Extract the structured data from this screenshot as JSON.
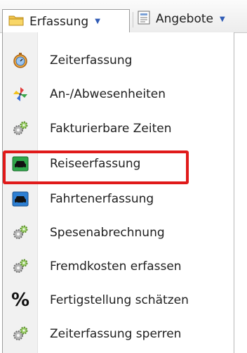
{
  "menubar": {
    "erfassung": {
      "label": "Erfassung",
      "icon": "folder-icon",
      "caret": "▼"
    },
    "angebote": {
      "label": "Angebote",
      "icon": "document-icon",
      "caret": "▼"
    }
  },
  "menu": {
    "items": [
      {
        "label": "Zeiterfassung",
        "icon": "stopwatch-icon"
      },
      {
        "label": "An-/Abwesenheiten",
        "icon": "pinwheel-icon"
      },
      {
        "label": "Fakturierbare Zeiten",
        "icon": "gears-icon"
      },
      {
        "label": "Reiseerfassung",
        "icon": "green-car-icon"
      },
      {
        "label": "Fahrtenerfassung",
        "icon": "blue-car-icon"
      },
      {
        "label": "Spesenabrechnung",
        "icon": "gears-icon"
      },
      {
        "label": "Fremdkosten erfassen",
        "icon": "gears-icon"
      },
      {
        "label": "Fertigstellung schätzen",
        "icon": "percent-icon"
      },
      {
        "label": "Zeiterfassung sperren",
        "icon": "gears-icon"
      }
    ],
    "percent_glyph": "%"
  },
  "colors": {
    "highlight": "#e01a1a",
    "caret": "#2f5bb5",
    "gutter": "#f1f1f1"
  }
}
